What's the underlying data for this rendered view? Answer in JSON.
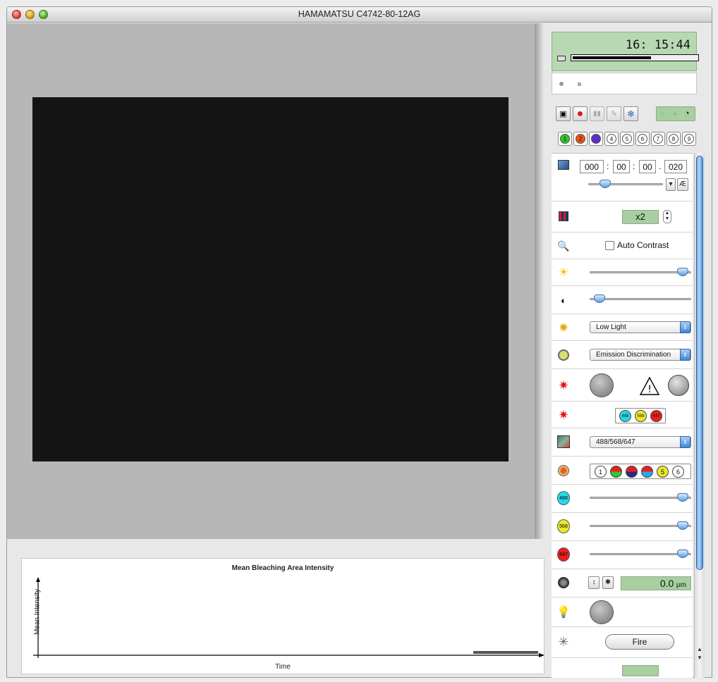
{
  "window": {
    "title": "HAMAMATSU C4742-80-12AG"
  },
  "clock": {
    "time": "16: 15:44",
    "disk_usage_fraction": 0.63
  },
  "toolbar": {
    "items": [
      {
        "name": "camera-icon",
        "glyph": "📷"
      },
      {
        "name": "record-icon",
        "glyph": "●"
      },
      {
        "name": "pause-icon",
        "glyph": "II"
      },
      {
        "name": "wrench-icon",
        "glyph": "⚒"
      },
      {
        "name": "snowflake-icon",
        "glyph": "❄"
      }
    ]
  },
  "channels": [
    {
      "label": "1",
      "color": "#2ec82e"
    },
    {
      "label": "2",
      "color": "#e8531c"
    },
    {
      "label": "",
      "color": "#5b2ec6"
    },
    {
      "label": "4",
      "color": "#ffffff"
    },
    {
      "label": "5",
      "color": "#ffffff"
    },
    {
      "label": "6",
      "color": "#ffffff"
    },
    {
      "label": "7",
      "color": "#ffffff"
    },
    {
      "label": "8",
      "color": "#ffffff"
    },
    {
      "label": "9",
      "color": "#ffffff"
    }
  ],
  "exposure": {
    "hours": "000",
    "minutes": "00",
    "seconds": "00",
    "ms": "020",
    "sep_colon": ":",
    "sep_dot": ".",
    "ae_label": "Æ"
  },
  "binning": {
    "value": "x2"
  },
  "contrast": {
    "label": "Auto Contrast",
    "checked": false
  },
  "brightness": {
    "level": 0.97
  },
  "gamma": {
    "level": 0.05
  },
  "mode": {
    "selected": "Low Light"
  },
  "filter": {
    "selected": "Emission Discrimination"
  },
  "lasers": {
    "warning": "!",
    "lines": [
      {
        "label": "488",
        "color": "#25d9e8"
      },
      {
        "label": "568",
        "color": "#e8e82a"
      },
      {
        "label": "647",
        "color": "#e81e1e"
      }
    ]
  },
  "dichroic": {
    "selected": "488/568/647"
  },
  "wheel": {
    "positions": [
      "1",
      "",
      "",
      "",
      "5",
      "6"
    ]
  },
  "laser_power": [
    {
      "label": "488",
      "color": "#25d9e8",
      "level": 0.97
    },
    {
      "label": "568",
      "color": "#e8e82a",
      "level": 0.97
    },
    {
      "label": "647",
      "color": "#e81e1e",
      "level": 0.97
    }
  ],
  "focus": {
    "value": "0.0",
    "unit": "µm"
  },
  "fire": {
    "label": "Fire"
  },
  "graph": {
    "title": "Mean Bleaching Area Intensity",
    "ylabel": "Mean Intensity",
    "xlabel": "Time"
  }
}
